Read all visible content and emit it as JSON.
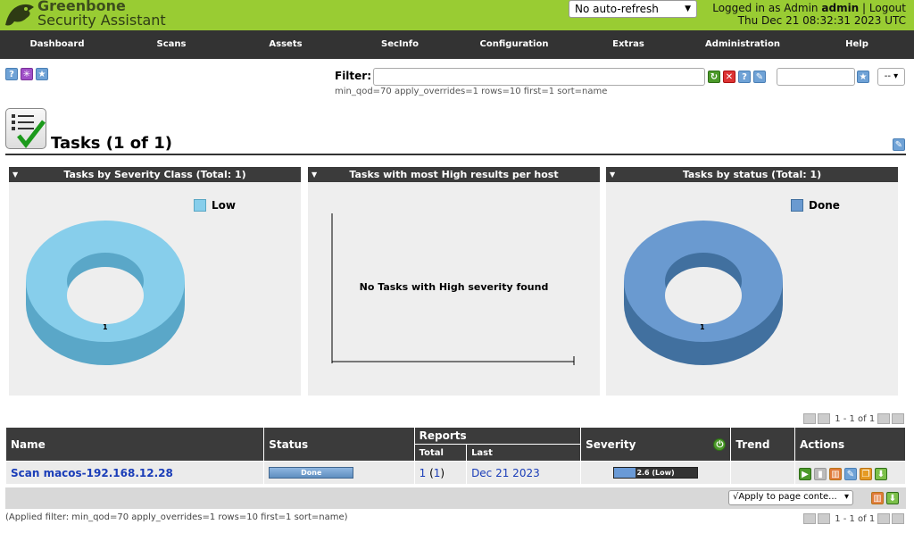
{
  "header": {
    "brand_line1": "Greenbone",
    "brand_line2": "Security Assistant",
    "refresh_select": "No auto-refresh",
    "logged_in_prefix": "Logged in as",
    "role": "Admin",
    "username": "admin",
    "logout": "Logout",
    "datetime": "Thu Dec 21 08:32:31 2023 UTC"
  },
  "nav": [
    "Dashboard",
    "Scans",
    "Assets",
    "SecInfo",
    "Configuration",
    "Extras",
    "Administration",
    "Help"
  ],
  "filter": {
    "label": "Filter:",
    "value": "",
    "applied": "min_qod=70 apply_overrides=1 rows=10 first=1 sort=name",
    "dropdown": "--"
  },
  "page": {
    "title": "Tasks (1 of 1)"
  },
  "panels": [
    {
      "title": "Tasks by Severity Class (Total: 1)",
      "legend": "Low",
      "count": "1",
      "color": "#87ceeb"
    },
    {
      "title": "Tasks with most High results per host",
      "message": "No Tasks with High severity found"
    },
    {
      "title": "Tasks by status (Total: 1)",
      "legend": "Done",
      "count": "1",
      "color": "#6a9ad0"
    }
  ],
  "pagination": "1 - 1 of 1",
  "table": {
    "headers": {
      "name": "Name",
      "status": "Status",
      "reports": "Reports",
      "total": "Total",
      "last": "Last",
      "severity": "Severity",
      "trend": "Trend",
      "actions": "Actions"
    },
    "rows": [
      {
        "name": "Scan macos-192.168.12.28",
        "status": "Done",
        "total": "1",
        "total_paren": "1",
        "last": "Dec 21 2023",
        "severity": "2.6 (Low)",
        "severity_value": 2.6
      }
    ],
    "apply_select": "√Apply to page conte..."
  },
  "applied_filter": "(Applied filter: min_qod=70 apply_overrides=1 rows=10 first=1 sort=name)",
  "colors": {
    "header": "#99cc33",
    "nav": "#333333",
    "link": "#1a3db8"
  }
}
